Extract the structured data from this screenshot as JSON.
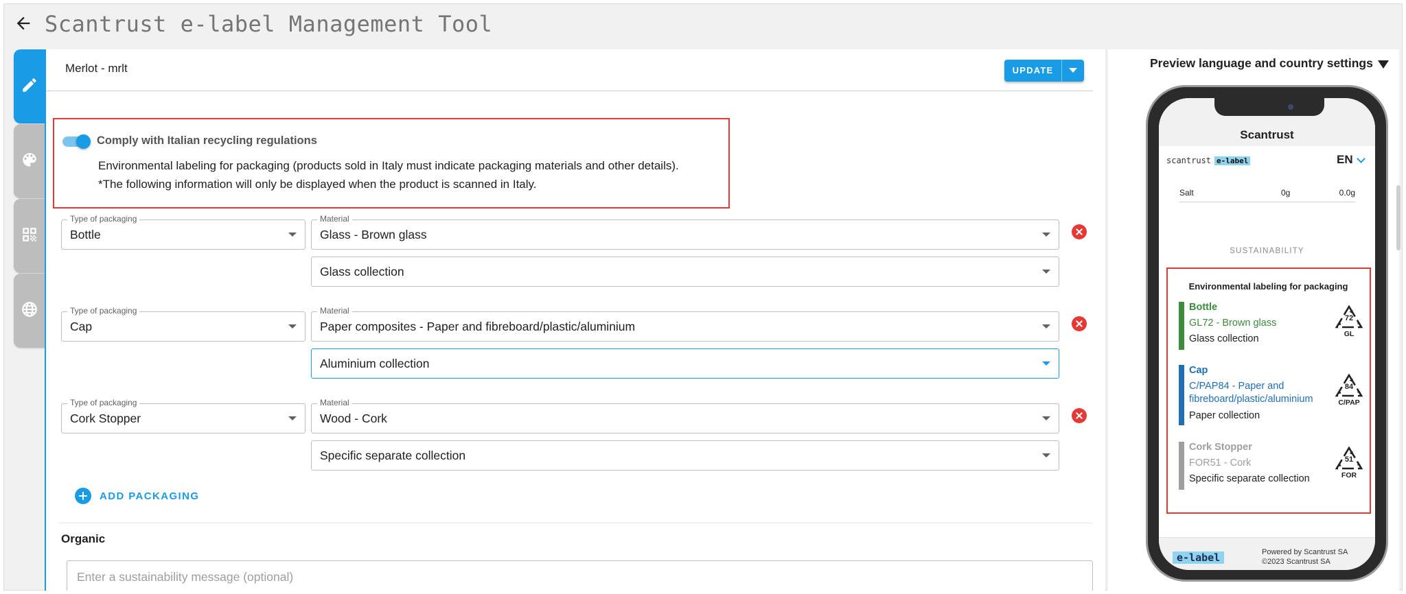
{
  "app": {
    "title": "Scantrust e-label Management Tool"
  },
  "editor": {
    "product_name": "Merlot - mrlt",
    "update_label": "UPDATE",
    "comply": {
      "label": "Comply with Italian recycling regulations",
      "enabled": true,
      "description": "Environmental labeling for packaging (products sold in Italy must indicate packaging materials and other details).",
      "note": "*The following information will only be displayed when the product is scanned in Italy."
    },
    "type_label": "Type of packaging",
    "material_label": "Material",
    "packaging": [
      {
        "type": "Bottle",
        "material": "Glass - Brown glass",
        "collection": "Glass collection"
      },
      {
        "type": "Cap",
        "material": "Paper composites - Paper and fibreboard/plastic/aluminium",
        "collection": "Aluminium collection"
      },
      {
        "type": "Cork Stopper",
        "material": "Wood - Cork",
        "collection": "Specific separate collection"
      }
    ],
    "add_packaging_label": "ADD PACKAGING",
    "organic_label": "Organic",
    "sustainability_placeholder": "Enter a sustainability message (optional)"
  },
  "preview": {
    "settings_label": "Preview language and country settings",
    "brand": "Scantrust",
    "logo_text": "scantrust",
    "logo_badge": "e-label",
    "language": "EN",
    "salt": {
      "label": "Salt",
      "v1": "0g",
      "v2": "0.0g"
    },
    "sustainability_heading": "SUSTAINABILITY",
    "box_title": "Environmental labeling for packaging",
    "items": [
      {
        "name": "Bottle",
        "material": "GL72 - Brown glass",
        "collection": "Glass collection",
        "number": "72",
        "code": "GL",
        "color": "#3d8b3d"
      },
      {
        "name": "Cap",
        "material": "C/PAP84 - Paper and fibreboard/plastic/aluminium",
        "collection": "Paper collection",
        "number": "84",
        "code": "C/PAP",
        "color": "#1f6fb5"
      },
      {
        "name": "Cork Stopper",
        "material": "FOR51 - Cork",
        "collection": "Specific separate collection",
        "number": "51",
        "code": "FOR",
        "color": "#9e9e9e"
      }
    ],
    "footer": {
      "logo": "e-label",
      "powered": "Powered by Scantrust SA",
      "copyright": "©2023 Scantrust SA"
    }
  },
  "colors": {
    "accent": "#1a9be6",
    "error": "#e53935",
    "tab_inactive": "#bdbdbd"
  },
  "icons": [
    "arrow-left-icon",
    "pencil-icon",
    "palette-icon",
    "qr-code-icon",
    "globe-icon",
    "close-circle-icon",
    "plus-circle-icon",
    "chevron-down-icon",
    "recycling-icon"
  ]
}
